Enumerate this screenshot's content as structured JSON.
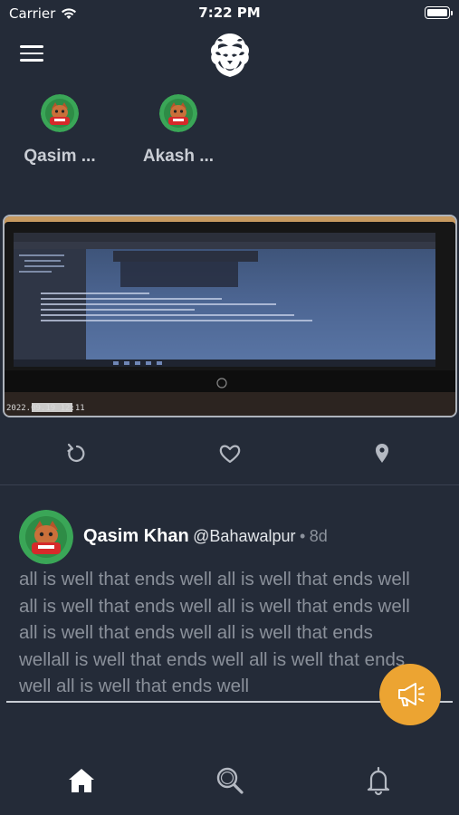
{
  "status_bar": {
    "carrier": "Carrier",
    "time": "7:22 PM"
  },
  "header": {
    "menu_icon": "hamburger-menu-icon",
    "logo": "lion-head-logo"
  },
  "stories": [
    {
      "name": "Qasim ..."
    },
    {
      "name": "Akash ..."
    }
  ],
  "post_media": {
    "photo_timestamp": "2022.09.19 12:11"
  },
  "actions": [
    {
      "icon": "repost-icon"
    },
    {
      "icon": "heart-icon"
    },
    {
      "icon": "location-pin-icon"
    }
  ],
  "post": {
    "author": "Qasim Khan",
    "handle": "@Bahawalpur",
    "separator": "•",
    "time": "8d",
    "lines": [
      "all is well that ends well all is well that ends well",
      "all is well that ends well all is well that ends well",
      "all is well that ends well all is well that ends",
      "wellall is well that ends well all is well that ends",
      "well all is well that ends well"
    ]
  },
  "fab": {
    "icon": "megaphone-icon"
  },
  "tabbar": [
    {
      "icon": "home-icon",
      "active": true
    },
    {
      "icon": "search-icon",
      "active": false
    },
    {
      "icon": "bell-icon",
      "active": false
    }
  ],
  "colors": {
    "background": "#242b38",
    "accent": "#eca432",
    "muted_text": "#8a909a"
  }
}
